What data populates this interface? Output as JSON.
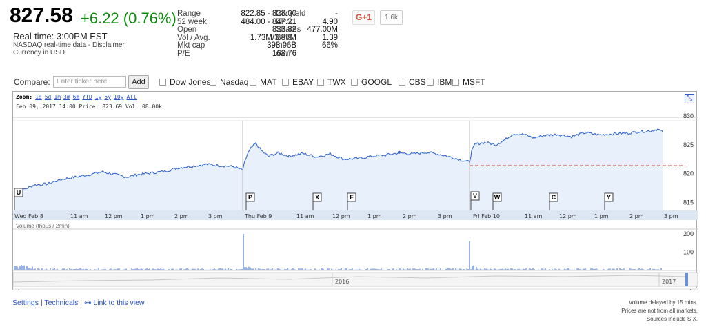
{
  "quote": {
    "price": "827.58",
    "change": "+6.22 (0.76%)",
    "realtime": "Real-time:   3:00PM EST",
    "disclaimer": "NASDAQ real-time data - Disclaimer",
    "currency": "Currency in USD"
  },
  "stats_left": [
    {
      "k": "Range",
      "v": "822.85 - 828.00"
    },
    {
      "k": "52 week",
      "v": "484.00 - 847.21"
    },
    {
      "k": "Open",
      "v": "823.82"
    },
    {
      "k": "Vol / Avg.",
      "v": "1.73M/3.87M"
    },
    {
      "k": "Mkt cap",
      "v": "393.06B"
    },
    {
      "k": "P/E",
      "v": "168.76"
    }
  ],
  "stats_right": [
    {
      "k": "Div/yield",
      "v": "-"
    },
    {
      "k": "EPS",
      "v": "4.90"
    },
    {
      "k": "Shares",
      "v": "477.00M"
    },
    {
      "k": "Beta",
      "v": "1.39"
    },
    {
      "k": "Inst. own",
      "v": "66%"
    }
  ],
  "social": {
    "gplus_label": "G+1",
    "count": "1.6k"
  },
  "compare": {
    "label": "Compare:",
    "placeholder": "Enter ticker here",
    "add_label": "Add",
    "tickers": [
      "Dow Jones",
      "Nasdaq",
      "MAT",
      "EBAY",
      "TWX",
      "GOOGL",
      "CBS",
      "IBM",
      "MSFT"
    ]
  },
  "chart": {
    "zoom_label": "Zoom:",
    "zoom_options": [
      "1d",
      "5d",
      "1m",
      "3m",
      "6m",
      "YTD",
      "1y",
      "5y",
      "10y",
      "All"
    ],
    "date_info": "Feb 09, 2017 14:00 Price: 823.69 Vol: 08.00k",
    "y_ticks": [
      "830",
      "825",
      "820",
      "815"
    ],
    "x_labels": [
      "Wed Feb 8",
      "11 am",
      "12 pm",
      "1 pm",
      "2 pm",
      "3 pm",
      "Thu Feb 9",
      "11 am",
      "12 pm",
      "1 pm",
      "2 pm",
      "3 pm",
      "Fri Feb 10",
      "11 am",
      "12 pm",
      "1 pm",
      "2 pm",
      "3 pm"
    ],
    "event_flags": [
      "U",
      "P",
      "X",
      "F",
      "V",
      "W",
      "C",
      "Y"
    ],
    "volume_label": "Volume (thous / 2min)",
    "volume_ticks": [
      "200",
      "100"
    ],
    "navigator_labels": [
      "2016",
      "2017"
    ],
    "line_color": "#3366cc",
    "fill_color": "#e8f1fb",
    "dash_color": "#cc0000"
  },
  "footer": {
    "settings": "Settings",
    "technicals": "Technicals",
    "link": "Link to this view",
    "notes": [
      "Volume delayed by 15 mins.",
      "Prices are not from all markets.",
      "Sources include SIX."
    ]
  }
}
